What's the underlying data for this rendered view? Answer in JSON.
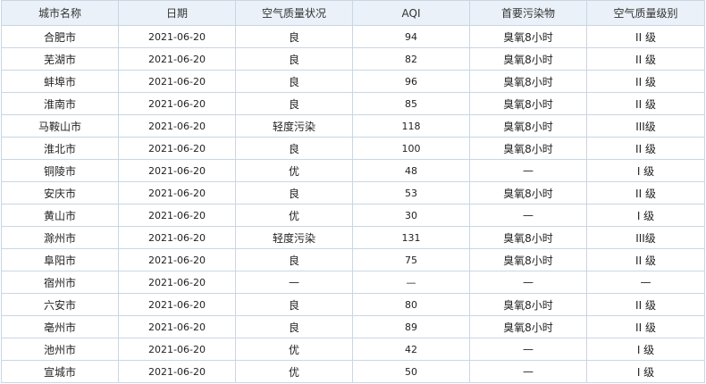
{
  "table": {
    "headers": [
      "城市名称",
      "日期",
      "空气质量状况",
      "AQI",
      "首要污染物",
      "空气质量级别"
    ],
    "rows": [
      [
        "合肥市",
        "2021-06-20",
        "良",
        "94",
        "臭氧8小时",
        "II 级"
      ],
      [
        "芜湖市",
        "2021-06-20",
        "良",
        "82",
        "臭氧8小时",
        "II 级"
      ],
      [
        "蚌埠市",
        "2021-06-20",
        "良",
        "96",
        "臭氧8小时",
        "II 级"
      ],
      [
        "淮南市",
        "2021-06-20",
        "良",
        "85",
        "臭氧8小时",
        "II 级"
      ],
      [
        "马鞍山市",
        "2021-06-20",
        "轻度污染",
        "118",
        "臭氧8小时",
        "III级"
      ],
      [
        "淮北市",
        "2021-06-20",
        "良",
        "100",
        "臭氧8小时",
        "II 级"
      ],
      [
        "铜陵市",
        "2021-06-20",
        "优",
        "48",
        "—",
        "I 级"
      ],
      [
        "安庆市",
        "2021-06-20",
        "良",
        "53",
        "臭氧8小时",
        "II 级"
      ],
      [
        "黄山市",
        "2021-06-20",
        "优",
        "30",
        "—",
        "I 级"
      ],
      [
        "滁州市",
        "2021-06-20",
        "轻度污染",
        "131",
        "臭氧8小时",
        "III级"
      ],
      [
        "阜阳市",
        "2021-06-20",
        "良",
        "75",
        "臭氧8小时",
        "II 级"
      ],
      [
        "宿州市",
        "2021-06-20",
        "—",
        "—",
        "—",
        "—"
      ],
      [
        "六安市",
        "2021-06-20",
        "良",
        "80",
        "臭氧8小时",
        "II 级"
      ],
      [
        "亳州市",
        "2021-06-20",
        "良",
        "89",
        "臭氧8小时",
        "II 级"
      ],
      [
        "池州市",
        "2021-06-20",
        "优",
        "42",
        "—",
        "I 级"
      ],
      [
        "宣城市",
        "2021-06-20",
        "优",
        "50",
        "—",
        "I 级"
      ]
    ]
  }
}
